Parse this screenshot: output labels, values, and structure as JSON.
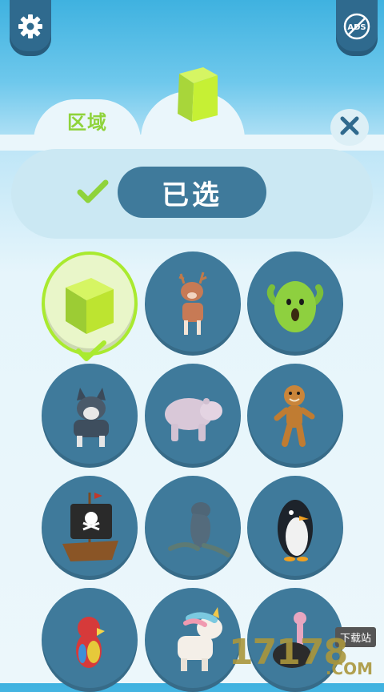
{
  "header": {
    "settings_icon": "gear-icon",
    "no_ads_icon": "no-ads-icon",
    "no_ads_text": "ADS"
  },
  "tabs": [
    {
      "label": "区域",
      "active": false
    },
    {
      "icon": "green-cube-icon",
      "active": true
    }
  ],
  "close_icon": "close-icon",
  "status": {
    "check_icon": "check-icon",
    "selected_label": "已选"
  },
  "skins": [
    {
      "name": "green-cube",
      "selected": true
    },
    {
      "name": "deer",
      "selected": false
    },
    {
      "name": "cactus",
      "selected": false
    },
    {
      "name": "wolf",
      "selected": false
    },
    {
      "name": "polar-bear",
      "selected": false
    },
    {
      "name": "gingerbread-man",
      "selected": false
    },
    {
      "name": "pirate-ship",
      "selected": false
    },
    {
      "name": "seal",
      "selected": false
    },
    {
      "name": "penguin",
      "selected": false
    },
    {
      "name": "parrot",
      "selected": false
    },
    {
      "name": "unicorn",
      "selected": false
    },
    {
      "name": "ostrich",
      "selected": false
    }
  ],
  "watermark": {
    "tag": "下载站",
    "number": "17178",
    "domain": ".COM"
  },
  "colors": {
    "accent_green": "#a9ea2f",
    "panel_blue": "#3f7a9b"
  }
}
